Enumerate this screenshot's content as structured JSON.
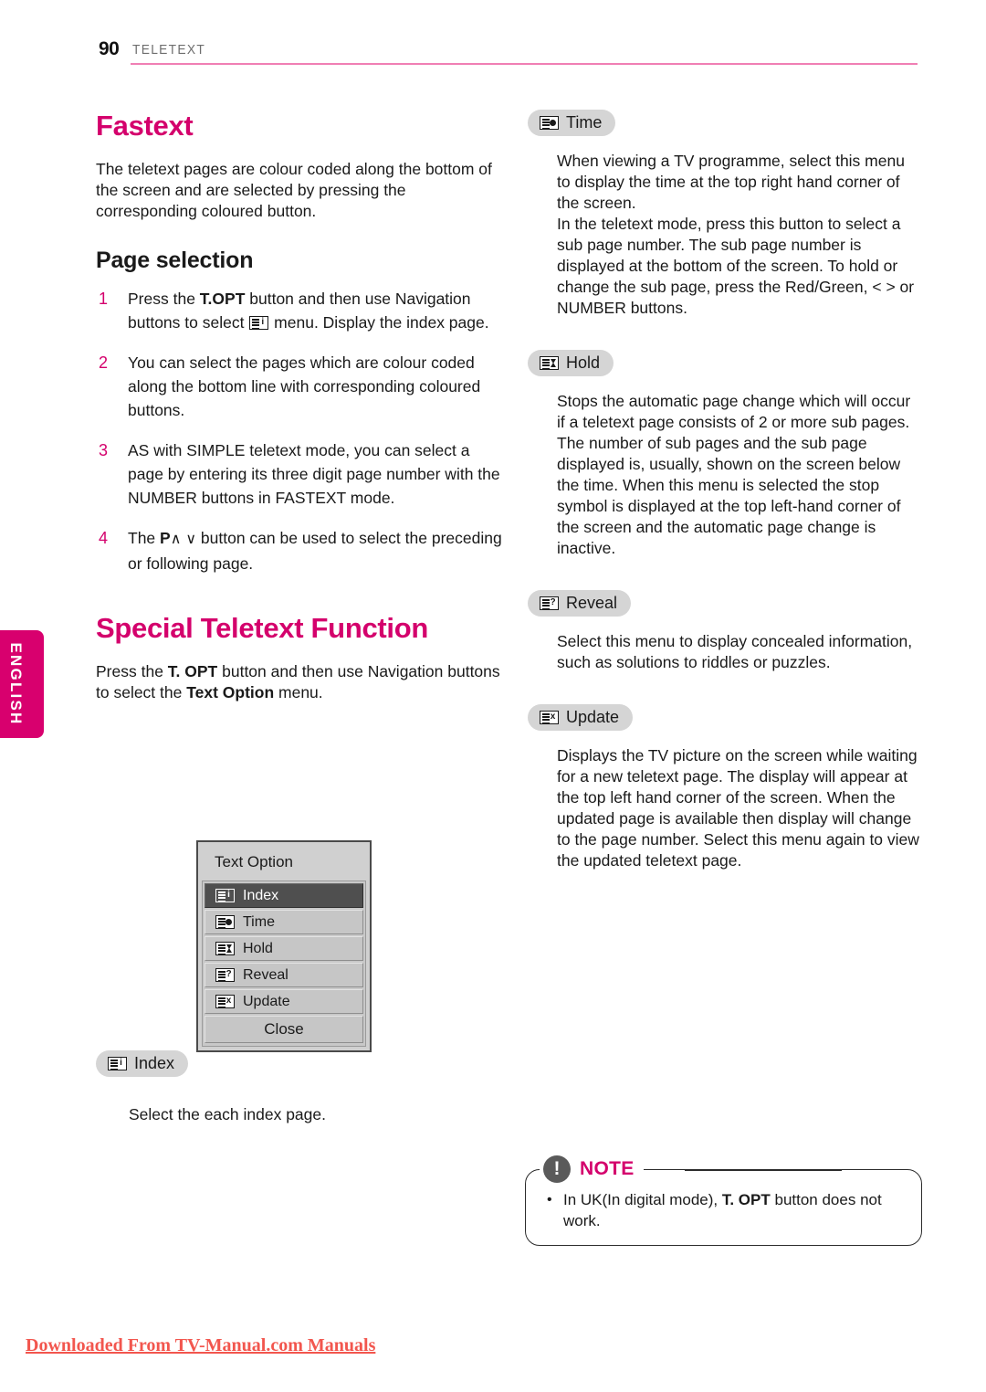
{
  "header": {
    "page_number": "90",
    "chapter": "TELETEXT",
    "rule_color": "#f07fb4"
  },
  "sidebar": {
    "language_tab": "ENGLISH",
    "tab_color": "#d8006e"
  },
  "colors": {
    "accent_pink": "#d4006c",
    "pill_grey": "#d5d5d5",
    "osd_grey": "#c6c6c6",
    "osd_selected": "#4f4f4f",
    "footer_red": "#f2564e"
  },
  "left_column": {
    "section_title": "Fastext",
    "intro": "The teletext pages are colour coded along the bottom of the screen and are selected by pressing the corresponding coloured button.",
    "subsection_title": "Page selection",
    "steps": [
      {
        "num": "1",
        "pre": "Press the ",
        "bold1": "T.OPT",
        "mid": " button and then use  Navigation buttons to select ",
        "icon": "teletext-index-icon",
        "post": " menu. Display the index page."
      },
      {
        "num": "2",
        "text": "You can select the pages which are colour coded along the bottom line with corresponding coloured buttons."
      },
      {
        "num": "3",
        "text": "AS with SIMPLE teletext mode, you can select a page by entering its three digit page number with the NUMBER buttons in FASTEXT mode."
      },
      {
        "num": "4",
        "pre": "The ",
        "bold1": "P",
        "chev_up": "∧",
        "chev_down": "∨",
        "post": " button can be used to select the preceding or following page."
      }
    ],
    "section2_title": "Special Teletext Function",
    "section2_pre": "Press the ",
    "section2_bold1": "T. OPT",
    "section2_mid": " button and then use Navigation buttons to select the ",
    "section2_bold2": "Text Option",
    "section2_post": " menu."
  },
  "osd_menu": {
    "title": "Text Option",
    "items": [
      {
        "label": "Index",
        "icon": "teletext-index-icon",
        "selected": true
      },
      {
        "label": "Time",
        "icon": "teletext-time-icon",
        "selected": false
      },
      {
        "label": "Hold",
        "icon": "teletext-hold-icon",
        "selected": false
      },
      {
        "label": "Reveal",
        "icon": "teletext-reveal-icon",
        "selected": false
      },
      {
        "label": "Update",
        "icon": "teletext-update-icon",
        "selected": false
      }
    ],
    "close_label": "Close"
  },
  "index_caption": {
    "pill_label": "Index",
    "text": "Select the each index page."
  },
  "right_column": {
    "blocks": [
      {
        "pill_label": "Time",
        "icon": "teletext-time-icon",
        "paragraphs": [
          "When viewing a TV programme, select this menu to display the time at the top right hand corner of the screen.",
          "In the teletext mode, press this button to select a sub page number. The sub page number is displayed at the bottom of the screen. To hold or change the sub page, press the Red/Green, < > or NUMBER buttons."
        ]
      },
      {
        "pill_label": "Hold",
        "icon": "teletext-hold-icon",
        "paragraphs": [
          "Stops the automatic page change which will occur if a teletext page consists of 2 or more sub pages.",
          "The number of sub pages and the sub page displayed is, usually, shown on the screen below the time. When this menu is selected the stop symbol is displayed at the top left-hand corner of the screen and the automatic page change is inactive."
        ]
      },
      {
        "pill_label": "Reveal",
        "icon": "teletext-reveal-icon",
        "paragraphs": [
          "Select this menu to display concealed information, such as solutions to riddles or puzzles."
        ]
      },
      {
        "pill_label": "Update",
        "icon": "teletext-update-icon",
        "paragraphs": [
          "Displays the TV picture on the screen while waiting for a new teletext page. The display will appear at the top left hand corner of the screen. When the updated page is available then display will change to the page number. Select this menu again to view the updated teletext page."
        ]
      }
    ]
  },
  "note": {
    "icon": "exclamation-icon",
    "label": "NOTE",
    "bullet": "•",
    "pre": "In UK(In digital mode), ",
    "bold": "T. OPT",
    "post": " button does not work."
  },
  "footer": {
    "text": "Downloaded From TV-Manual.com Manuals"
  }
}
